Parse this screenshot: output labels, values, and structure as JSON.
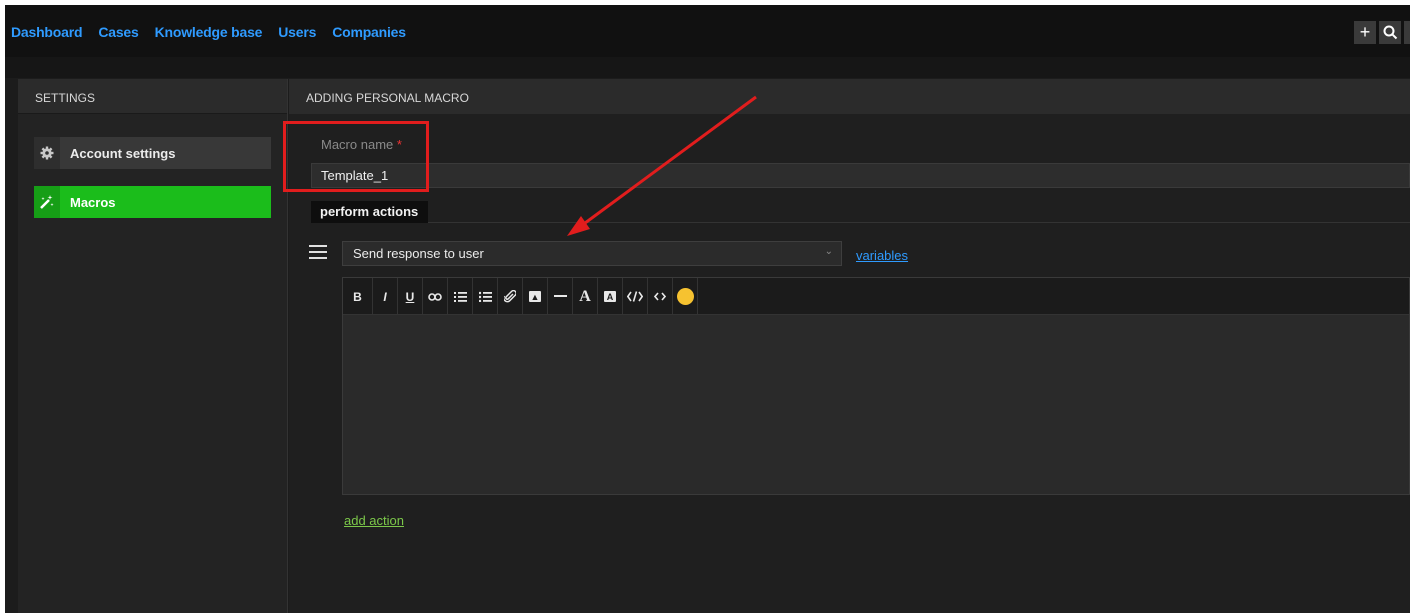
{
  "topnav": {
    "items": [
      "Dashboard",
      "Cases",
      "Knowledge base",
      "Users",
      "Companies"
    ],
    "actions": [
      "+",
      "search-icon"
    ]
  },
  "sidebar": {
    "heading": "SETTINGS",
    "items": [
      {
        "label": "Account settings",
        "icon": "gear-icon"
      },
      {
        "label": "Macros",
        "icon": "magic-wand-icon",
        "active": true
      }
    ]
  },
  "main": {
    "heading": "ADDING PERSONAL MACRO",
    "macro_name_label": "Macro name",
    "required_mark": "*",
    "macro_name_value": "Template_1",
    "perform_tab": "perform actions",
    "action_select_value": "Send response to user",
    "variables_link": "variables",
    "add_action_link": "add action"
  },
  "toolbar": {
    "buttons": [
      "B",
      "I",
      "U",
      "link-icon",
      "ordered-list-icon",
      "unordered-list-icon",
      "attach-icon",
      "image-icon",
      "horizontal-rule-icon",
      "A",
      "highlight-icon",
      "code-block-icon",
      "code-inline-icon",
      "emoji-icon"
    ]
  },
  "colors": {
    "link": "#2f9bff",
    "active_item": "#1bbd1b",
    "annotation": "#e11d1d",
    "add_action": "#7cc84a"
  }
}
